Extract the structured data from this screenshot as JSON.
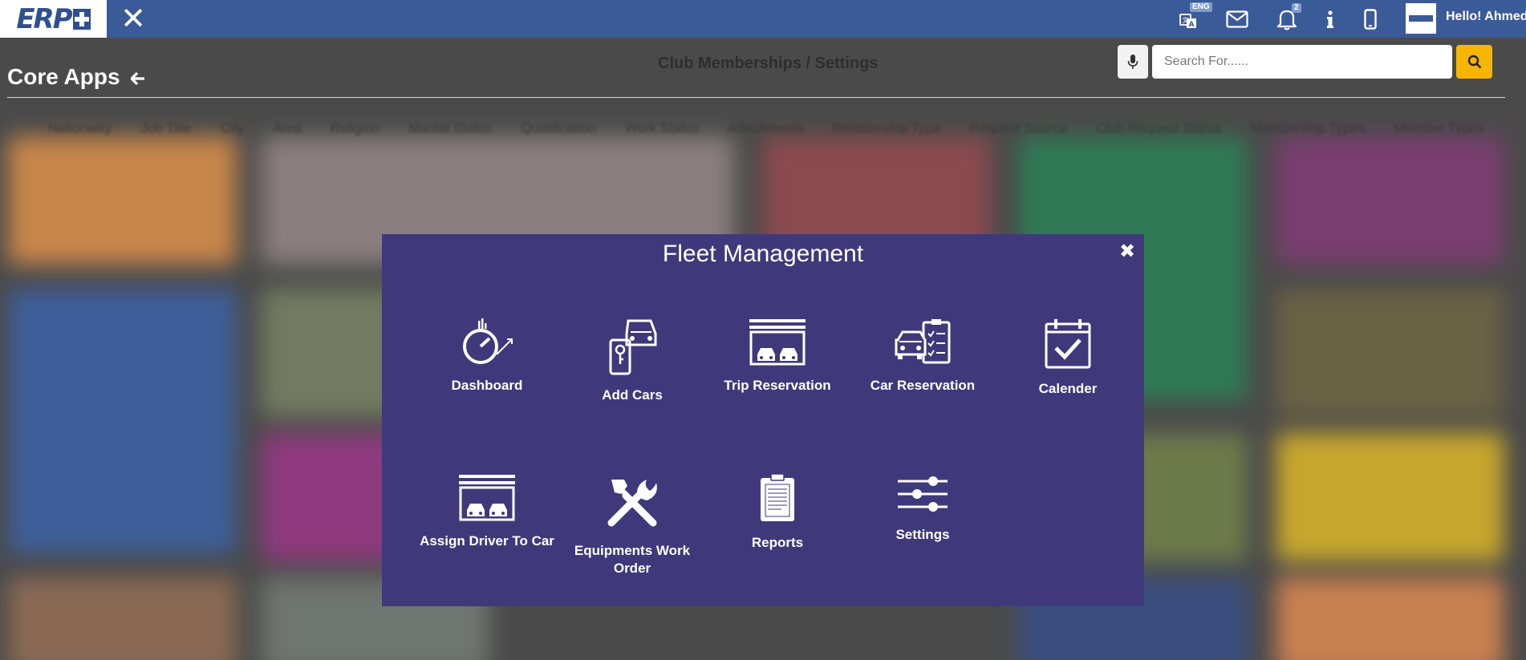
{
  "topbar": {
    "logo_text": "ERP",
    "close_symbol": "✕",
    "language_badge": "ENG",
    "notification_count": "2",
    "greeting": "Hello! Ahmed",
    "icons": [
      "translate-icon",
      "mail-icon",
      "bell-icon",
      "info-icon",
      "mobile-icon",
      "avatar"
    ]
  },
  "background": {
    "core_title": "Core Apps",
    "back_arrow": "🡐",
    "breadcrumb": "Club Memberships / Settings",
    "tabs": [
      "Nationality",
      "Job Title",
      "City",
      "Area",
      "Religion",
      "Marital Status",
      "Qualification",
      "Work Status",
      "Attachments",
      "Relationship Type",
      "Request Source",
      "Club Request Status",
      "Membership Types",
      "Member Types"
    ]
  },
  "search": {
    "placeholder": "Search For......",
    "value": ""
  },
  "modal": {
    "title": "Fleet Management",
    "close_symbol": "✖",
    "apps": [
      {
        "label": "Dashboard",
        "icon": "speedometer-icon"
      },
      {
        "label": "Add Cars",
        "icon": "car-key-icon"
      },
      {
        "label": "Trip Reservation",
        "icon": "garage-icon"
      },
      {
        "label": "Car Reservation",
        "icon": "car-checklist-icon"
      },
      {
        "label": "Calender",
        "icon": "calendar-check-icon"
      },
      {
        "label": "Assign Driver To Car",
        "icon": "garage-icon"
      },
      {
        "label": "Equipments Work Order",
        "icon": "tools-icon"
      },
      {
        "label": "Reports",
        "icon": "clipboard-icon"
      },
      {
        "label": "Settings",
        "icon": "sliders-icon"
      }
    ]
  },
  "colors": {
    "topbar": "#3b5a98",
    "modal": "#3f397b",
    "search_button": "#f7b500",
    "overlay_bg": "#4a4a4a"
  }
}
